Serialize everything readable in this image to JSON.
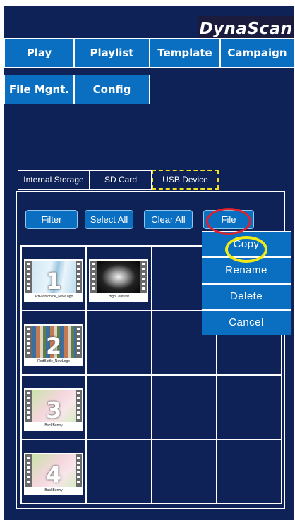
{
  "brand": "DynaScan",
  "nav": [
    "Play",
    "Playlist",
    "Template",
    "Campaign",
    "File Mgnt.",
    "Config"
  ],
  "tabs": [
    "Internal Storage",
    "SD Card",
    "USB Device"
  ],
  "actions": {
    "filter": "Filter",
    "select_all": "Select All",
    "clear_all": "Clear All",
    "file": "File"
  },
  "files": [
    {
      "name": "ArtFashionInk_NewLogo",
      "number": "1"
    },
    {
      "name": "HighContrast",
      "number": ""
    },
    {
      "name": "RedBattle_NewLogo",
      "number": "2"
    },
    {
      "name": "BuckBunny",
      "number": "3"
    },
    {
      "name": "BuckBunny",
      "number": "4"
    }
  ],
  "file_menu": [
    "Copy",
    "Rename",
    "Delete",
    "Cancel"
  ],
  "colors": {
    "background": "#0f2258",
    "button": "#0a6fc1",
    "highlight_file": "#e0202a",
    "highlight_copy": "#f2ea16"
  },
  "icons": {
    "thumbnail": "film-strip-icon"
  }
}
